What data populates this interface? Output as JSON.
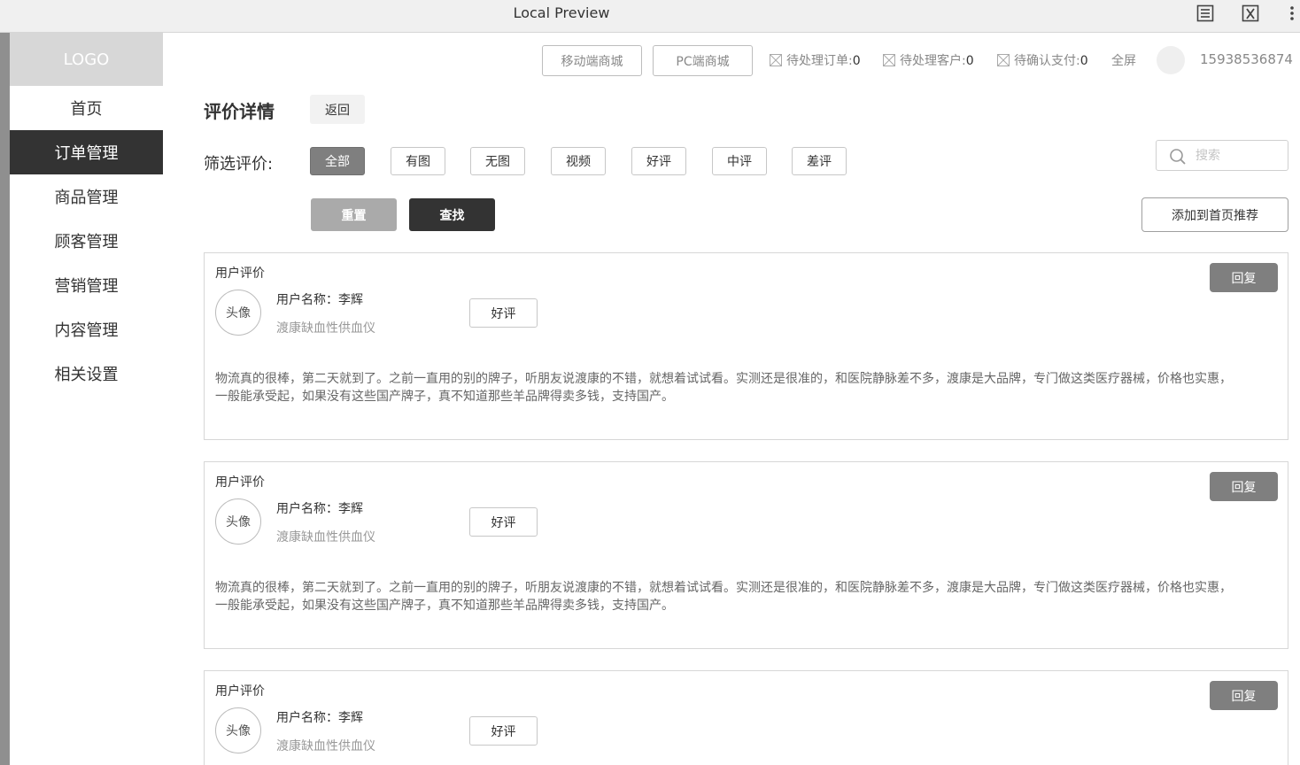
{
  "window": {
    "title": "Local Preview"
  },
  "sidebar": {
    "logo": "LOGO",
    "items": [
      {
        "label": "首页",
        "active": false
      },
      {
        "label": "订单管理",
        "active": true
      },
      {
        "label": "商品管理",
        "active": false
      },
      {
        "label": "顾客管理",
        "active": false
      },
      {
        "label": "营销管理",
        "active": false
      },
      {
        "label": "内容管理",
        "active": false
      },
      {
        "label": "相关设置",
        "active": false
      }
    ]
  },
  "header": {
    "mobile_mall": "移动端商城",
    "pc_mall": "PC端商城",
    "pending_orders_label": "待处理订单:",
    "pending_orders_count": "0",
    "pending_customers_label": "待处理客户:",
    "pending_customers_count": "0",
    "pending_payments_label": "待确认支付:",
    "pending_payments_count": "0",
    "fullscreen": "全屏",
    "phone": "15938536874"
  },
  "page": {
    "title": "评价详情",
    "back": "返回"
  },
  "filters": {
    "label": "筛选评价:",
    "options": [
      "全部",
      "有图",
      "无图",
      "视频",
      "好评",
      "中评",
      "差评"
    ],
    "selected": "全部",
    "search_placeholder": "搜索",
    "reset": "重置",
    "find": "查找",
    "add_recommend": "添加到首页推荐"
  },
  "reviews": [
    {
      "heading": "用户评价",
      "avatar": "头像",
      "user": "用户名称：李辉",
      "product": "渡康缺血性供血仪",
      "rating": "好评",
      "reply": "回复",
      "text": "物流真的很棒，第二天就到了。之前一直用的别的牌子，听朋友说渡康的不错，就想着试试看。实测还是很准的，和医院静脉差不多，渡康是大品牌，专门做这类医疗器械，价格也实惠，一般能承受起，如果没有这些国产牌子，真不知道那些羊品牌得卖多钱，支持国产。"
    },
    {
      "heading": "用户评价",
      "avatar": "头像",
      "user": "用户名称：李辉",
      "product": "渡康缺血性供血仪",
      "rating": "好评",
      "reply": "回复",
      "text": "物流真的很棒，第二天就到了。之前一直用的别的牌子，听朋友说渡康的不错，就想着试试看。实测还是很准的，和医院静脉差不多，渡康是大品牌，专门做这类医疗器械，价格也实惠，一般能承受起，如果没有这些国产牌子，真不知道那些羊品牌得卖多钱，支持国产。"
    },
    {
      "heading": "用户评价",
      "avatar": "头像",
      "user": "用户名称：李辉",
      "product": "渡康缺血性供血仪",
      "rating": "好评",
      "reply": "回复",
      "text": ""
    }
  ],
  "colors": {
    "sidebar_active": "#333333",
    "filter_active": "#7f7f7f",
    "reply_button": "#7f7f7f",
    "logo_bg": "#d7d7d7"
  },
  "icons": [
    "document-icon",
    "excel-icon",
    "more-icon",
    "search-icon",
    "checkbox-icon"
  ]
}
